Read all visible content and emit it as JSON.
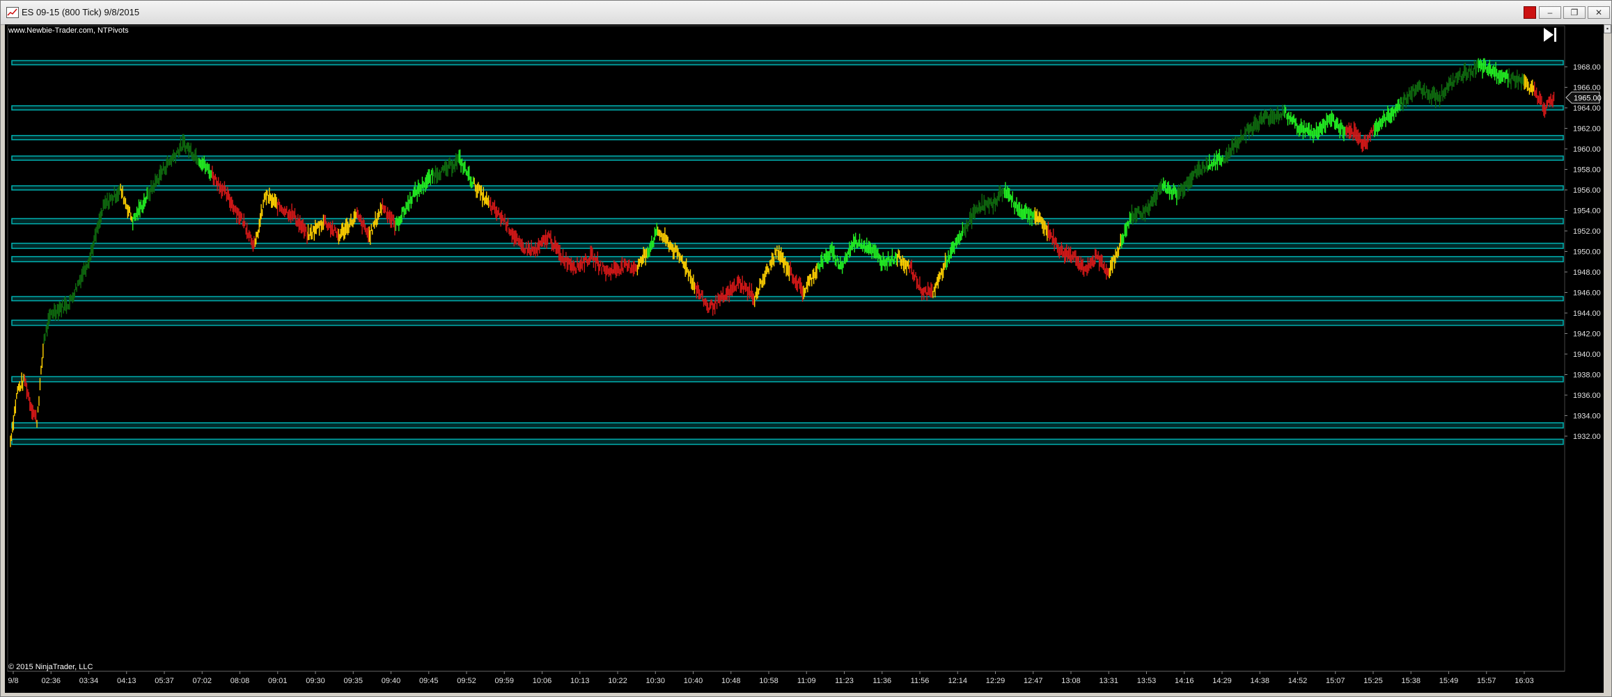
{
  "window": {
    "title": "ES 09-15 (800 Tick)  9/8/2015"
  },
  "chart": {
    "watermark": "www.Newbie-Trader.com, NTPivots",
    "copyright": "© 2015 NinjaTrader, LLC",
    "last_price_label": "1965.00",
    "background_color": "#000000",
    "zone_color": "#00b0b0",
    "bar_colors": {
      "dark_green": "#0f6a0f",
      "bright_green": "#22ee22",
      "yellow": "#ffd000",
      "red": "#d41818"
    },
    "icons": {
      "go_to_end": "skip-forward-icon",
      "app": "chart-app-icon"
    }
  },
  "chart_data": {
    "type": "bar",
    "title": "ES 09-15 (800 Tick)  9/8/2015",
    "ylim": [
      1930.5,
      1970.0
    ],
    "y_ticks": [
      "1932.00",
      "1934.00",
      "1936.00",
      "1938.00",
      "1940.00",
      "1942.00",
      "1944.00",
      "1946.00",
      "1948.00",
      "1950.00",
      "1952.00",
      "1954.00",
      "1956.00",
      "1958.00",
      "1960.00",
      "1962.00",
      "1964.00",
      "1966.00",
      "1968.00"
    ],
    "x_ticks": [
      "9/8",
      "02:36",
      "03:34",
      "04:13",
      "05:37",
      "07:02",
      "08:08",
      "09:01",
      "09:30",
      "09:35",
      "09:40",
      "09:45",
      "09:52",
      "09:59",
      "10:06",
      "10:13",
      "10:22",
      "10:30",
      "10:40",
      "10:48",
      "10:58",
      "11:09",
      "11:23",
      "11:36",
      "11:56",
      "12:14",
      "12:29",
      "12:47",
      "13:08",
      "13:31",
      "13:53",
      "14:16",
      "14:29",
      "14:38",
      "14:52",
      "15:07",
      "15:25",
      "15:38",
      "15:49",
      "15:57",
      "16:03"
    ],
    "pivot_zones": [
      [
        1931.2,
        1931.7
      ],
      [
        1932.8,
        1933.3
      ],
      [
        1937.3,
        1937.8
      ],
      [
        1942.8,
        1943.3
      ],
      [
        1945.2,
        1945.6
      ],
      [
        1949.0,
        1949.5
      ],
      [
        1950.3,
        1950.8
      ],
      [
        1952.7,
        1953.2
      ],
      [
        1956.0,
        1956.4
      ],
      [
        1958.9,
        1959.3
      ],
      [
        1960.9,
        1961.3
      ],
      [
        1963.8,
        1964.2
      ],
      [
        1968.2,
        1968.6
      ]
    ],
    "price_path": [
      {
        "t": 0,
        "p": 1931.5,
        "c": "red"
      },
      {
        "t": 7,
        "p": 1936.5,
        "c": "yellow"
      },
      {
        "t": 14,
        "p": 1937.5,
        "c": "yellow"
      },
      {
        "t": 20,
        "p": 1935.0,
        "c": "red"
      },
      {
        "t": 26,
        "p": 1933.5,
        "c": "red"
      },
      {
        "t": 33,
        "p": 1941.5,
        "c": "yellow"
      },
      {
        "t": 40,
        "p": 1944.0,
        "c": "dark_green"
      },
      {
        "t": 58,
        "p": 1945.0,
        "c": "dark_green"
      },
      {
        "t": 78,
        "p": 1949.5,
        "c": "dark_green"
      },
      {
        "t": 92,
        "p": 1954.5,
        "c": "dark_green"
      },
      {
        "t": 108,
        "p": 1956.0,
        "c": "dark_green"
      },
      {
        "t": 120,
        "p": 1953.0,
        "c": "yellow"
      },
      {
        "t": 135,
        "p": 1955.5,
        "c": "bright_green"
      },
      {
        "t": 150,
        "p": 1958.0,
        "c": "dark_green"
      },
      {
        "t": 170,
        "p": 1960.5,
        "c": "dark_green"
      },
      {
        "t": 185,
        "p": 1959.0,
        "c": "dark_green"
      },
      {
        "t": 198,
        "p": 1957.5,
        "c": "bright_green"
      },
      {
        "t": 212,
        "p": 1955.5,
        "c": "red"
      },
      {
        "t": 228,
        "p": 1953.0,
        "c": "red"
      },
      {
        "t": 240,
        "p": 1950.5,
        "c": "red"
      },
      {
        "t": 250,
        "p": 1955.5,
        "c": "yellow"
      },
      {
        "t": 262,
        "p": 1954.5,
        "c": "yellow"
      },
      {
        "t": 278,
        "p": 1953.5,
        "c": "red"
      },
      {
        "t": 292,
        "p": 1951.5,
        "c": "red"
      },
      {
        "t": 308,
        "p": 1953.0,
        "c": "yellow"
      },
      {
        "t": 322,
        "p": 1951.5,
        "c": "red"
      },
      {
        "t": 340,
        "p": 1953.5,
        "c": "yellow"
      },
      {
        "t": 352,
        "p": 1951.5,
        "c": "red"
      },
      {
        "t": 365,
        "p": 1954.5,
        "c": "yellow"
      },
      {
        "t": 378,
        "p": 1952.5,
        "c": "red"
      },
      {
        "t": 395,
        "p": 1955.5,
        "c": "bright_green"
      },
      {
        "t": 415,
        "p": 1957.5,
        "c": "bright_green"
      },
      {
        "t": 428,
        "p": 1958.0,
        "c": "dark_green"
      },
      {
        "t": 440,
        "p": 1959.0,
        "c": "dark_green"
      },
      {
        "t": 455,
        "p": 1956.5,
        "c": "bright_green"
      },
      {
        "t": 470,
        "p": 1954.5,
        "c": "yellow"
      },
      {
        "t": 485,
        "p": 1953.0,
        "c": "red"
      },
      {
        "t": 500,
        "p": 1950.5,
        "c": "red"
      },
      {
        "t": 515,
        "p": 1950.0,
        "c": "red"
      },
      {
        "t": 528,
        "p": 1951.5,
        "c": "red"
      },
      {
        "t": 540,
        "p": 1949.5,
        "c": "red"
      },
      {
        "t": 555,
        "p": 1948.5,
        "c": "red"
      },
      {
        "t": 570,
        "p": 1949.5,
        "c": "red"
      },
      {
        "t": 585,
        "p": 1948.0,
        "c": "red"
      },
      {
        "t": 600,
        "p": 1948.5,
        "c": "red"
      },
      {
        "t": 615,
        "p": 1948.5,
        "c": "red"
      },
      {
        "t": 625,
        "p": 1950.0,
        "c": "yellow"
      },
      {
        "t": 635,
        "p": 1952.0,
        "c": "bright_green"
      },
      {
        "t": 648,
        "p": 1950.5,
        "c": "yellow"
      },
      {
        "t": 660,
        "p": 1949.0,
        "c": "yellow"
      },
      {
        "t": 672,
        "p": 1946.5,
        "c": "yellow"
      },
      {
        "t": 685,
        "p": 1944.5,
        "c": "red"
      },
      {
        "t": 700,
        "p": 1945.5,
        "c": "red"
      },
      {
        "t": 715,
        "p": 1947.0,
        "c": "red"
      },
      {
        "t": 730,
        "p": 1945.5,
        "c": "red"
      },
      {
        "t": 742,
        "p": 1948.0,
        "c": "yellow"
      },
      {
        "t": 752,
        "p": 1950.0,
        "c": "yellow"
      },
      {
        "t": 765,
        "p": 1948.0,
        "c": "yellow"
      },
      {
        "t": 778,
        "p": 1946.0,
        "c": "red"
      },
      {
        "t": 792,
        "p": 1948.5,
        "c": "yellow"
      },
      {
        "t": 805,
        "p": 1950.0,
        "c": "bright_green"
      },
      {
        "t": 815,
        "p": 1948.5,
        "c": "bright_green"
      },
      {
        "t": 828,
        "p": 1951.0,
        "c": "bright_green"
      },
      {
        "t": 842,
        "p": 1950.5,
        "c": "bright_green"
      },
      {
        "t": 855,
        "p": 1949.0,
        "c": "bright_green"
      },
      {
        "t": 870,
        "p": 1949.5,
        "c": "bright_green"
      },
      {
        "t": 882,
        "p": 1948.5,
        "c": "yellow"
      },
      {
        "t": 895,
        "p": 1946.0,
        "c": "red"
      },
      {
        "t": 905,
        "p": 1946.0,
        "c": "red"
      },
      {
        "t": 918,
        "p": 1949.0,
        "c": "yellow"
      },
      {
        "t": 935,
        "p": 1952.0,
        "c": "bright_green"
      },
      {
        "t": 950,
        "p": 1954.5,
        "c": "dark_green"
      },
      {
        "t": 962,
        "p": 1954.5,
        "c": "dark_green"
      },
      {
        "t": 975,
        "p": 1956.0,
        "c": "dark_green"
      },
      {
        "t": 990,
        "p": 1954.0,
        "c": "bright_green"
      },
      {
        "t": 1005,
        "p": 1953.5,
        "c": "bright_green"
      },
      {
        "t": 1018,
        "p": 1952.0,
        "c": "yellow"
      },
      {
        "t": 1030,
        "p": 1950.0,
        "c": "red"
      },
      {
        "t": 1045,
        "p": 1949.5,
        "c": "red"
      },
      {
        "t": 1055,
        "p": 1948.0,
        "c": "red"
      },
      {
        "t": 1065,
        "p": 1949.5,
        "c": "red"
      },
      {
        "t": 1078,
        "p": 1948.0,
        "c": "red"
      },
      {
        "t": 1090,
        "p": 1951.0,
        "c": "yellow"
      },
      {
        "t": 1100,
        "p": 1953.5,
        "c": "bright_green"
      },
      {
        "t": 1115,
        "p": 1954.0,
        "c": "dark_green"
      },
      {
        "t": 1130,
        "p": 1956.5,
        "c": "dark_green"
      },
      {
        "t": 1145,
        "p": 1955.5,
        "c": "bright_green"
      },
      {
        "t": 1160,
        "p": 1957.5,
        "c": "dark_green"
      },
      {
        "t": 1175,
        "p": 1958.5,
        "c": "dark_green"
      },
      {
        "t": 1190,
        "p": 1959.0,
        "c": "bright_green"
      },
      {
        "t": 1210,
        "p": 1961.5,
        "c": "dark_green"
      },
      {
        "t": 1230,
        "p": 1963.0,
        "c": "dark_green"
      },
      {
        "t": 1250,
        "p": 1963.5,
        "c": "dark_green"
      },
      {
        "t": 1265,
        "p": 1962.0,
        "c": "bright_green"
      },
      {
        "t": 1280,
        "p": 1961.5,
        "c": "bright_green"
      },
      {
        "t": 1295,
        "p": 1963.0,
        "c": "bright_green"
      },
      {
        "t": 1310,
        "p": 1961.5,
        "c": "bright_green"
      },
      {
        "t": 1318,
        "p": 1961.5,
        "c": "red"
      },
      {
        "t": 1328,
        "p": 1960.5,
        "c": "red"
      },
      {
        "t": 1338,
        "p": 1962.0,
        "c": "red"
      },
      {
        "t": 1350,
        "p": 1963.0,
        "c": "bright_green"
      },
      {
        "t": 1365,
        "p": 1964.5,
        "c": "bright_green"
      },
      {
        "t": 1380,
        "p": 1966.0,
        "c": "dark_green"
      },
      {
        "t": 1400,
        "p": 1965.0,
        "c": "dark_green"
      },
      {
        "t": 1420,
        "p": 1967.0,
        "c": "dark_green"
      },
      {
        "t": 1440,
        "p": 1968.0,
        "c": "dark_green"
      },
      {
        "t": 1455,
        "p": 1967.5,
        "c": "bright_green"
      },
      {
        "t": 1470,
        "p": 1967.0,
        "c": "bright_green"
      },
      {
        "t": 1485,
        "p": 1966.5,
        "c": "dark_green"
      },
      {
        "t": 1495,
        "p": 1965.5,
        "c": "yellow"
      },
      {
        "t": 1505,
        "p": 1964.0,
        "c": "red"
      },
      {
        "t": 1515,
        "p": 1965.0,
        "c": "red"
      }
    ]
  }
}
